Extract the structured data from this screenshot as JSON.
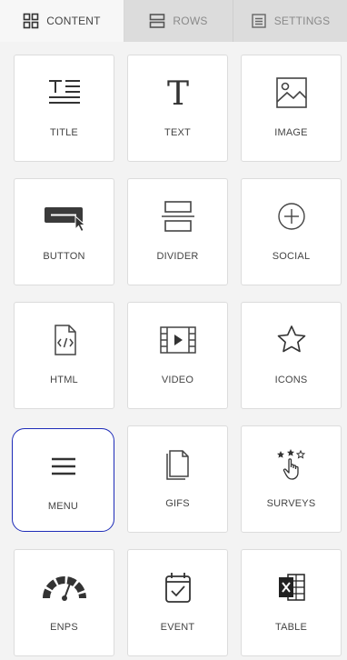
{
  "tabs": [
    {
      "label": "CONTENT",
      "icon": "grid-icon",
      "active": true
    },
    {
      "label": "ROWS",
      "icon": "rows-icon",
      "active": false
    },
    {
      "label": "SETTINGS",
      "icon": "settings-icon",
      "active": false
    }
  ],
  "blocks": [
    {
      "label": "TITLE",
      "icon": "title-icon"
    },
    {
      "label": "TEXT",
      "icon": "text-icon"
    },
    {
      "label": "IMAGE",
      "icon": "image-icon"
    },
    {
      "label": "BUTTON",
      "icon": "button-icon"
    },
    {
      "label": "DIVIDER",
      "icon": "divider-icon"
    },
    {
      "label": "SOCIAL",
      "icon": "social-plus-icon"
    },
    {
      "label": "HTML",
      "icon": "html-code-icon"
    },
    {
      "label": "VIDEO",
      "icon": "video-icon"
    },
    {
      "label": "ICONS",
      "icon": "star-icon"
    },
    {
      "label": "MENU",
      "icon": "hamburger-menu-icon",
      "selected": true
    },
    {
      "label": "GIFS",
      "icon": "document-icon"
    },
    {
      "label": "SURVEYS",
      "icon": "stars-hand-icon"
    },
    {
      "label": "ENPS",
      "icon": "gauge-icon"
    },
    {
      "label": "EVENT",
      "icon": "calendar-check-icon"
    },
    {
      "label": "TABLE",
      "icon": "excel-table-icon"
    }
  ],
  "colors": {
    "selected_border": "#1d2bb8",
    "icon": "#444444"
  }
}
